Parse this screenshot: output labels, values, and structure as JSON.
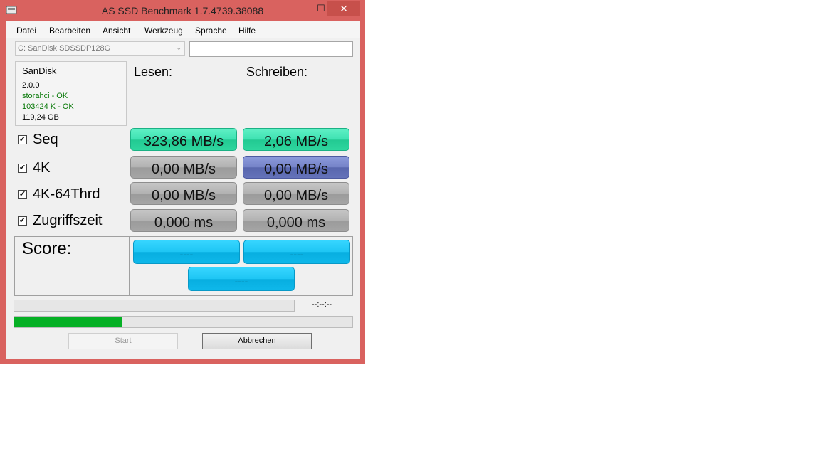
{
  "window": {
    "title": "AS SSD Benchmark 1.7.4739.38088"
  },
  "titlebar_buttons": {
    "minimize": "—",
    "maximize": "☐",
    "close": "✕"
  },
  "menu": [
    "Datei",
    "Bearbeiten",
    "Ansicht",
    "Werkzeug",
    "Sprache",
    "Hilfe"
  ],
  "drive": {
    "selected": "C: SanDisk SDSSDP128G",
    "arrow": "⌄"
  },
  "info": {
    "name": "SanDisk",
    "version": "2.0.0",
    "driver": "storahci - OK",
    "alignment": "103424 K - OK",
    "size": "119,24 GB"
  },
  "headers": {
    "read": "Lesen:",
    "write": "Schreiben:"
  },
  "rows": [
    {
      "label": "Seq",
      "checked": "✔",
      "read": "323,86 MB/s",
      "write": "2,06 MB/s"
    },
    {
      "label": "4K",
      "checked": "✔",
      "read": "0,00 MB/s",
      "write": "0,00 MB/s"
    },
    {
      "label": "4K-64Thrd",
      "checked": "✔",
      "read": "0,00 MB/s",
      "write": "0,00 MB/s"
    },
    {
      "label": "Zugriffszeit",
      "checked": "✔",
      "read": "0,000 ms",
      "write": "0,000 ms"
    }
  ],
  "score": {
    "label": "Score:",
    "read": "----",
    "write": "----",
    "total": "----"
  },
  "progress": {
    "time": "--:--:--",
    "overall_fraction": 0.32
  },
  "buttons": {
    "start": "Start",
    "cancel": "Abbrechen"
  },
  "colors": {
    "frame": "#d9625f",
    "green": "#2ed69e",
    "gray": "#a5a5a5",
    "blue": "#6472b9",
    "cyan": "#0fb8ea",
    "progress": "#06b025",
    "ok_text": "#0a7a0a"
  }
}
